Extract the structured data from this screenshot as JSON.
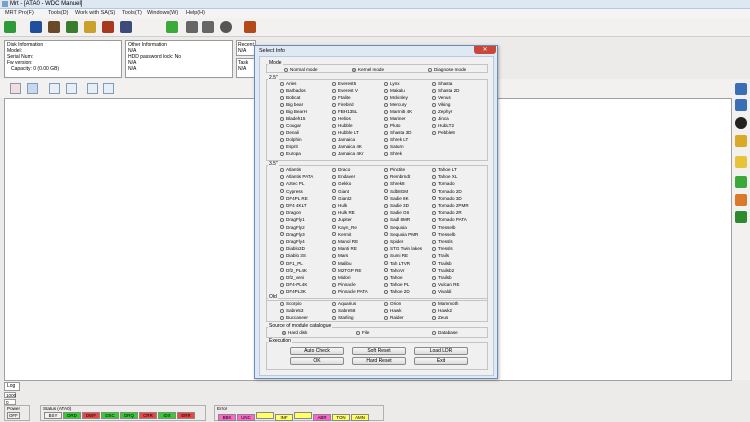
{
  "app": {
    "title": "Mrt - [ATA0 - WDC Manuel]"
  },
  "menu": [
    "MRT Pro(F)",
    "Tools(D)",
    "Work with SA(S)",
    "Tools(T)",
    "Windows(W)",
    "Help(H)"
  ],
  "toolbar_icons": [
    "connect-icon",
    "wrench-icon",
    "pen-icon",
    "flag-icon",
    "bag-icon",
    "star-icon",
    "chart-icon",
    "play-icon",
    "stop-icon",
    "pause-icon",
    "close-circle-icon",
    "exit-icon"
  ],
  "info": {
    "disk": {
      "title": "Disk Information",
      "lines": [
        "Model:",
        "Serial Num:",
        "Fw version:",
        "Capacity: 0 (0.00 GB)"
      ]
    },
    "other": {
      "title": "Other Information",
      "lines": [
        "N/A",
        "HDD password lock: No",
        "N/A",
        "N/A"
      ]
    },
    "recent": {
      "title": "Recent",
      "lines": [
        "N/A"
      ]
    },
    "task": {
      "title": "Task",
      "lines": [
        "N/A"
      ]
    }
  },
  "log": {
    "tab": "Log",
    "value1": "1000",
    "value2": "0"
  },
  "status": {
    "power_label": "Power",
    "power_value": "OFF",
    "status_label": "Status (ATA0)",
    "status_items": [
      "BSY",
      "DRD",
      "DWF",
      "DSC",
      "DRQ",
      "CRR",
      "IDX",
      "ERR"
    ],
    "error_label": "Error",
    "error_items": [
      "BBK",
      "UNC",
      "",
      "INF",
      "",
      "ABR",
      "TON",
      "AMN"
    ]
  },
  "dialog": {
    "title": "Select Info",
    "close": "✕",
    "mode": {
      "label": "Mode",
      "options": [
        {
          "label": "Normal mode",
          "on": false
        },
        {
          "label": "Kernel mode",
          "on": true
        },
        {
          "label": "Diagnose mode",
          "on": false
        }
      ]
    },
    "g25": {
      "label": "2.5\"",
      "cols": [
        [
          "Aries",
          "Barbados",
          "Bobcat",
          "Big bear",
          "Big BearH",
          "Bladeh15",
          "Cougar",
          "Denali",
          "Dolphin",
          "Esprit",
          "Europa"
        ],
        [
          "Everest5",
          "Everest V",
          "Ftalite",
          "Firebird",
          "FBH135L",
          "Helios",
          "Hubble",
          "Hubble LT",
          "Jamaica",
          "Jamaica 4K",
          "Jamaica 4Kr"
        ],
        [
          "Lynx",
          "Makalu",
          "Mckinley",
          "Mercury",
          "Marmi5 4K",
          "Mariner",
          "Pluto",
          "Shasta 3D",
          "Shrek LT",
          "Saturn",
          "Shrek"
        ],
        [
          "Shasta",
          "Shasta 2D",
          "Venus",
          "Viking",
          "Zephyr",
          "Jinca",
          "HubLT2",
          "Pebble8"
        ]
      ]
    },
    "g35": {
      "label": "3.5\"",
      "cols": [
        [
          "Atlantis",
          "Atlantis PATA",
          "Aztec PL",
          "Cypress",
          "DF4PL RE",
          "DF4 4KLT",
          "Dragon",
          "DragFly1",
          "DragFly2",
          "DragFly3",
          "DragFly4",
          "Diablo3D",
          "Diablo 3S",
          "DF1_PL",
          "Df2_PL4K",
          "Df2_veni",
          "DF4-PL4K",
          "DF4PL3K"
        ],
        [
          "Draco",
          "Endaver",
          "Gekko",
          "Giant",
          "Giant2",
          "Hulk",
          "Hulk RE",
          "Jupiter",
          "Kayn_Re",
          "Kermit",
          "Manol RE",
          "Manti RE",
          "Mars",
          "Malibu",
          "M2TGP RE",
          "Midori",
          "Pinnacle",
          "Pinnacle PATA"
        ],
        [
          "Pinctite",
          "Rembrndt",
          "Shrek8",
          "Sdb8GM",
          "Sadie 8K",
          "Sadie 3D",
          "Sadie G6",
          "Sadl 8MR",
          "Sequoia",
          "Sequoia PMR",
          "Spider",
          "STG Twin lakes",
          "Sumi RE",
          "Tah LTVR",
          "TahoVr",
          "Tahoe",
          "Tahoe PL",
          "Tahoe 2D"
        ],
        [
          "Tahoe LT",
          "Tahoe XL",
          "Tornado",
          "Tornado 2D",
          "Tornado 3D",
          "Tornado 2PMR",
          "Tornado 2R",
          "Tornado PATA",
          "Tresselb",
          "Tresselb",
          "Tressls",
          "Tressls",
          "Trails",
          "Trailsb",
          "Trailsb2",
          "Trailsb",
          "Vulcan RE",
          "Vivaldi"
        ]
      ]
    },
    "old": {
      "label": "Old",
      "cols": [
        [
          "Scorpio",
          "Sabre53",
          "Buccaneer"
        ],
        [
          "Aquarius",
          "Sabre58",
          "Starling"
        ],
        [
          "Orion",
          "Hawk",
          "Raider"
        ],
        [
          "Mammoth",
          "Hawk2",
          "Zeus"
        ]
      ]
    },
    "source": {
      "label": "Source of module catalogue",
      "options": [
        {
          "label": "Hard disk",
          "on": true
        },
        {
          "label": "File",
          "on": false
        },
        {
          "label": "Database",
          "on": false
        }
      ]
    },
    "execution": {
      "label": "Execution",
      "buttons": [
        [
          "Auto Check",
          "Soft Reset",
          "Load LDR"
        ],
        [
          "OK",
          "Hard Reset",
          "Exit"
        ]
      ]
    }
  },
  "colors": {
    "toolbar_icons": [
      "#2e9b3a",
      "#1f4f9c",
      "#6b4a2a",
      "#3a7d2f",
      "#c9a12a",
      "#a53a1e",
      "#3c4a7a",
      "#3aaa3a",
      "#666666",
      "#666666",
      "#555555",
      "#b34a1a"
    ],
    "status_items": [
      "#f0f0f0",
      "#33cc33",
      "#ee4444",
      "#33cc33",
      "#33cc33",
      "#ee4444",
      "#33cc33",
      "#ee4444"
    ],
    "error_items": [
      "#ff66cc",
      "#ff66cc",
      "#ffff66",
      "#ffff66",
      "#ffff66",
      "#ff66cc",
      "#ffff66",
      "#ffff66"
    ]
  }
}
